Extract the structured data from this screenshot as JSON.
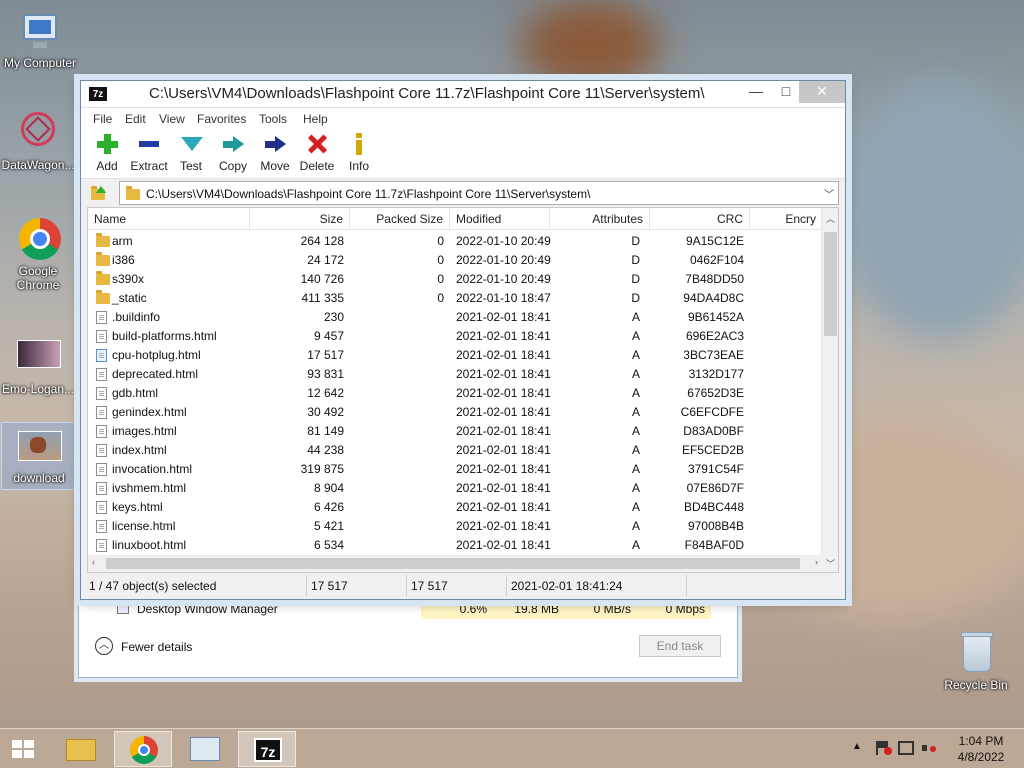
{
  "desktop": {
    "icons": [
      {
        "label": "My Computer"
      },
      {
        "label": "DataWagon..."
      },
      {
        "label": "Google Chrome"
      },
      {
        "label": "Emo-Logan..."
      },
      {
        "label": "download"
      },
      {
        "label": "Recycle Bin"
      }
    ]
  },
  "taskmanager": {
    "row": {
      "name": "Desktop Window Manager",
      "cpu": "0.6%",
      "memory": "19.8 MB",
      "disk": "0 MB/s",
      "network": "0 Mbps"
    },
    "fewer_details": "Fewer details",
    "end_task": "End task"
  },
  "window": {
    "logo": "7z",
    "title": "C:\\Users\\VM4\\Downloads\\Flashpoint Core 11.7z\\Flashpoint Core 11\\Server\\system\\",
    "controls": {
      "minimize": "—",
      "maximize": "□",
      "close": "✕"
    }
  },
  "menu": [
    "File",
    "Edit",
    "View",
    "Favorites",
    "Tools",
    "Help"
  ],
  "toolbar": [
    {
      "label": "Add",
      "icon": "plus-icon",
      "color": "#2bb02b"
    },
    {
      "label": "Extract",
      "icon": "minus-icon",
      "color": "#1f3ca8"
    },
    {
      "label": "Test",
      "icon": "check-icon",
      "color": "#2aa8b8"
    },
    {
      "label": "Copy",
      "icon": "copy-arrow-icon",
      "color": "#1f9a9a"
    },
    {
      "label": "Move",
      "icon": "move-arrow-icon",
      "color": "#1f2f8a"
    },
    {
      "label": "Delete",
      "icon": "x-icon",
      "color": "#d42020"
    },
    {
      "label": "Info",
      "icon": "info-icon",
      "color": "#d4a800"
    }
  ],
  "address": {
    "path": "C:\\Users\\VM4\\Downloads\\Flashpoint Core 11.7z\\Flashpoint Core 11\\Server\\system\\"
  },
  "columns": [
    "Name",
    "Size",
    "Packed Size",
    "Modified",
    "Attributes",
    "CRC",
    "Encry"
  ],
  "rows": [
    {
      "type": "folder",
      "name": "arm",
      "size": "264 128",
      "packed": "0",
      "modified": "2022-01-10 20:49",
      "attr": "D",
      "crc": "9A15C12E"
    },
    {
      "type": "folder",
      "name": "i386",
      "size": "24 172",
      "packed": "0",
      "modified": "2022-01-10 20:49",
      "attr": "D",
      "crc": "0462F104"
    },
    {
      "type": "folder",
      "name": "s390x",
      "size": "140 726",
      "packed": "0",
      "modified": "2022-01-10 20:49",
      "attr": "D",
      "crc": "7B48DD50"
    },
    {
      "type": "folder",
      "name": "_static",
      "size": "411 335",
      "packed": "0",
      "modified": "2022-01-10 18:47",
      "attr": "D",
      "crc": "94DA4D8C"
    },
    {
      "type": "file",
      "name": ".buildinfo",
      "size": "230",
      "packed": "",
      "modified": "2021-02-01 18:41",
      "attr": "A",
      "crc": "9B61452A"
    },
    {
      "type": "file",
      "name": "build-platforms.html",
      "size": "9 457",
      "packed": "",
      "modified": "2021-02-01 18:41",
      "attr": "A",
      "crc": "696E2AC3"
    },
    {
      "type": "html",
      "name": "cpu-hotplug.html",
      "size": "17 517",
      "packed": "",
      "modified": "2021-02-01 18:41",
      "attr": "A",
      "crc": "3BC73EAE"
    },
    {
      "type": "file",
      "name": "deprecated.html",
      "size": "93 831",
      "packed": "",
      "modified": "2021-02-01 18:41",
      "attr": "A",
      "crc": "3132D177"
    },
    {
      "type": "file",
      "name": "gdb.html",
      "size": "12 642",
      "packed": "",
      "modified": "2021-02-01 18:41",
      "attr": "A",
      "crc": "67652D3E"
    },
    {
      "type": "file",
      "name": "genindex.html",
      "size": "30 492",
      "packed": "",
      "modified": "2021-02-01 18:41",
      "attr": "A",
      "crc": "C6EFCDFE"
    },
    {
      "type": "file",
      "name": "images.html",
      "size": "81 149",
      "packed": "",
      "modified": "2021-02-01 18:41",
      "attr": "A",
      "crc": "D83AD0BF"
    },
    {
      "type": "file",
      "name": "index.html",
      "size": "44 238",
      "packed": "",
      "modified": "2021-02-01 18:41",
      "attr": "A",
      "crc": "EF5CED2B"
    },
    {
      "type": "file",
      "name": "invocation.html",
      "size": "319 875",
      "packed": "",
      "modified": "2021-02-01 18:41",
      "attr": "A",
      "crc": "3791C54F"
    },
    {
      "type": "file",
      "name": "ivshmem.html",
      "size": "8 904",
      "packed": "",
      "modified": "2021-02-01 18:41",
      "attr": "A",
      "crc": "07E86D7F"
    },
    {
      "type": "file",
      "name": "keys.html",
      "size": "6 426",
      "packed": "",
      "modified": "2021-02-01 18:41",
      "attr": "A",
      "crc": "BD4BC448"
    },
    {
      "type": "file",
      "name": "license.html",
      "size": "5 421",
      "packed": "",
      "modified": "2021-02-01 18:41",
      "attr": "A",
      "crc": "97008B4B"
    },
    {
      "type": "file",
      "name": "linuxboot.html",
      "size": "6 534",
      "packed": "",
      "modified": "2021-02-01 18:41",
      "attr": "A",
      "crc": "F84BAF0D"
    }
  ],
  "status": {
    "selected": "1 / 47 object(s) selected",
    "size": "17 517",
    "packed": "17 517",
    "modified": "2021-02-01 18:41:24"
  },
  "taskbar": {
    "time": "1:04 PM",
    "date": "4/8/2022"
  }
}
